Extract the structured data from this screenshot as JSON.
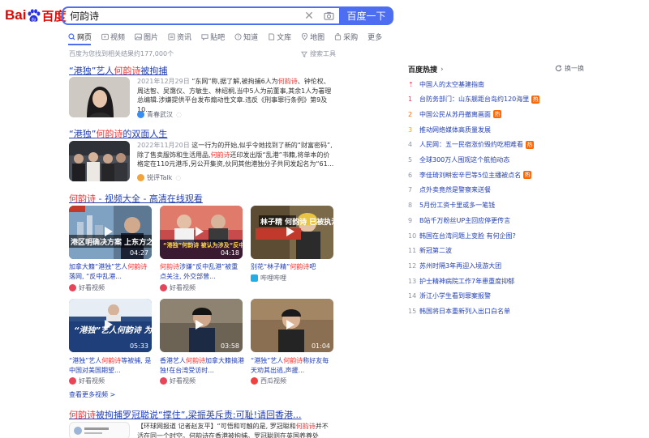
{
  "header": {
    "logo_text_left": "Bai",
    "logo_text_right": "百度",
    "query": "何韵诗",
    "search_button": "百度一下"
  },
  "tabs": [
    {
      "label": "网页",
      "icon": "web-icon"
    },
    {
      "label": "视频",
      "icon": "video-icon"
    },
    {
      "label": "图片",
      "icon": "image-icon"
    },
    {
      "label": "资讯",
      "icon": "news-icon"
    },
    {
      "label": "贴吧",
      "icon": "tieba-icon"
    },
    {
      "label": "知道",
      "icon": "zhidao-icon"
    },
    {
      "label": "文库",
      "icon": "wenku-icon"
    },
    {
      "label": "地图",
      "icon": "map-icon"
    },
    {
      "label": "采购",
      "icon": "purchase-icon"
    },
    {
      "label": "更多",
      "icon": ""
    }
  ],
  "result_count": "百度为您找到相关结果约177,000个",
  "tools_label": "搜索工具",
  "results": [
    {
      "title_pre": "“港独”艺人",
      "title_hl": "何韵诗",
      "title_post": "被拘捕",
      "date": "2021年12月29日",
      "snippet_1": "“东网”称,据了解,被拘捕6人为",
      "snippet_hl": "何韵诗",
      "snippet_2": "、钟伦权、周达智、吴霭仪、方敏生、林绍桐,当中5人为前董事,其余1人为署理总编辑.涉嫌提供平台发布煽动性文章.违反《刑事罪行条例》第9及10...",
      "source": "青春武汉"
    },
    {
      "title_pre": "“港独”",
      "title_hl": "何韵诗",
      "title_post": "的双面人生",
      "date": "2022年11月20日",
      "snippet_1": "这一行为的开始,似乎令她找到了新的“财富密码”,除了售卖服饰和生活用品,",
      "snippet_hl": "何韵诗",
      "snippet_2": "还印发出版“乱港”书籍,将单本的价格定在110元港币,另公开集资,伙同其他港独分子共同发起名为“61...",
      "source": "锐评Talk"
    }
  ],
  "video_section": {
    "title_hl": "何韵诗",
    "title_rest": " - 视频大全 - 高清在线观看",
    "more": "查看更多视频 >",
    "videos": [
      {
        "pre": "加拿大籍“港独”艺人",
        "hl": "何韵诗",
        "post": "落网, “反中乱港...",
        "source": "好看视频",
        "duration": "04:27",
        "overlay": "港区明确决方案 上东方之珠再"
      },
      {
        "pre": "",
        "hl": "何韵诗",
        "post": "涉嫌“反中乱港”被重点关注, 外交部曾...",
        "source": "好看视频",
        "duration": "04:18",
        "overlay": "“港独”何韵诗 被认为涉及“反中乱港”"
      },
      {
        "pre": "别花“林子精”",
        "hl": "何韵诗",
        "post": "吧",
        "source": "哔哩哔哩",
        "duration": "",
        "overlay": "林子精 何韵诗 已被执法部门"
      },
      {
        "pre": "“港独”艺人",
        "hl": "何韵诗",
        "post": "等被捕, 是中国对美国期望...",
        "source": "好看视频",
        "duration": "05:33",
        "overlay": "“港独”艺人何韵诗 为什么被捕"
      },
      {
        "pre": "香港艺人",
        "hl": "何韵诗",
        "post": "加拿大籍搞港独!在台湾受访时...",
        "source": "好看视频",
        "duration": "03:58",
        "overlay": ""
      },
      {
        "pre": "“港独”艺人",
        "hl": "何韵诗",
        "post": "称好友每天劝其出逃,声援...",
        "source": "西瓜视频",
        "duration": "01:04",
        "overlay": ""
      }
    ]
  },
  "result3": {
    "title_hl": "何韵诗",
    "title_rest": "被拘捕罗冠聪说“撑住”,梁振英斥责:可耻!请回香港...",
    "snippet_pre": "【环球网报道 记者赵友平】“可悟和可触的是, 罗冠聪和",
    "snippet_hl": "何韵诗",
    "snippet_post": "并不活在同一个时空。何韵诗在香港被拘捕。罗冠聪则在英国养尊处优...”香港"
  },
  "hotlist": {
    "title": "百度热搜",
    "refresh": "换一换",
    "items": [
      {
        "idx": "",
        "text": "中国人的太空基建指南",
        "badge": "",
        "badge_color": ""
      },
      {
        "idx": "1",
        "text": "台防务部门：山东舰距台岛约120海里",
        "badge": "热",
        "badge_color": "#ff6600"
      },
      {
        "idx": "2",
        "text": "中国公民从苏丹撤离画面",
        "badge": "热",
        "badge_color": "#ff6600"
      },
      {
        "idx": "3",
        "text": "推动网络媒体高质量发展",
        "badge": "",
        "badge_color": ""
      },
      {
        "idx": "4",
        "text": "人民网：五一民宿涨价毁约吃相难看",
        "badge": "热",
        "badge_color": "#ff6600"
      },
      {
        "idx": "5",
        "text": "全球300万人围观这个航拍动态",
        "badge": "",
        "badge_color": ""
      },
      {
        "idx": "6",
        "text": "李佳琦刘畊宏辛巴等5位主播被点名",
        "badge": "热",
        "badge_color": "#ff6600"
      },
      {
        "idx": "7",
        "text": "点外卖竟然是警察来送餐",
        "badge": "",
        "badge_color": ""
      },
      {
        "idx": "8",
        "text": "5月份工资卡里或多一笔钱",
        "badge": "",
        "badge_color": ""
      },
      {
        "idx": "9",
        "text": "B站千万粉丝UP主回应停更传言",
        "badge": "",
        "badge_color": ""
      },
      {
        "idx": "10",
        "text": "韩国在台湾问题上变脸 有何企图?",
        "badge": "",
        "badge_color": ""
      },
      {
        "idx": "11",
        "text": "新冠第二波",
        "badge": "",
        "badge_color": ""
      },
      {
        "idx": "12",
        "text": "苏州时隔3年再迎入境游大团",
        "badge": "",
        "badge_color": ""
      },
      {
        "idx": "13",
        "text": "护士精神病院工作7年患重度抑郁",
        "badge": "",
        "badge_color": ""
      },
      {
        "idx": "14",
        "text": "浙江小学生看到罪案报警",
        "badge": "",
        "badge_color": ""
      },
      {
        "idx": "15",
        "text": "韩国将日本重新列入出口白名单",
        "badge": "",
        "badge_color": ""
      }
    ]
  }
}
